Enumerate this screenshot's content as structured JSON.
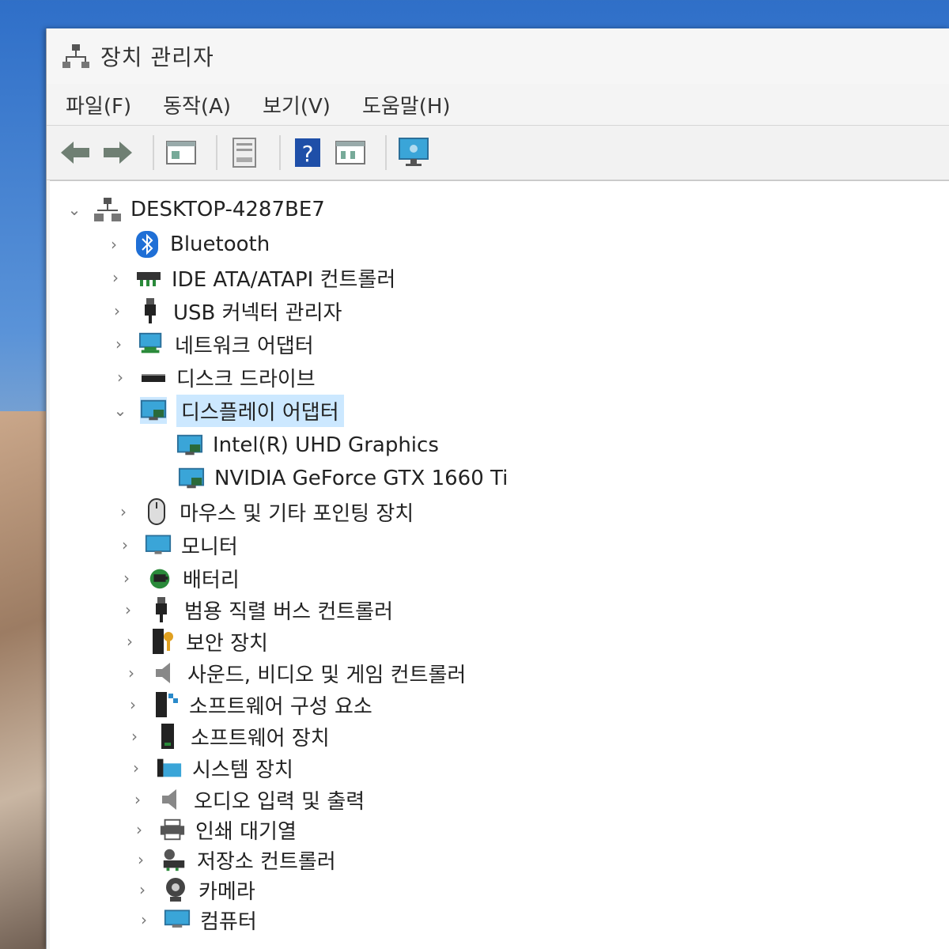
{
  "window": {
    "title": "장치 관리자"
  },
  "menu": [
    "파일(F)",
    "동작(A)",
    "보기(V)",
    "도움말(H)"
  ],
  "toolbar": [
    "back-icon",
    "forward-icon",
    "properties-icon",
    "update-driver-icon",
    "help-icon",
    "view-icon",
    "monitor-scan-icon"
  ],
  "tree": {
    "root": "DESKTOP-4287BE7",
    "items": [
      {
        "label": "Bluetooth",
        "icon": "bluetooth-icon",
        "expanded": false
      },
      {
        "label": "IDE ATA/ATAPI 컨트롤러",
        "icon": "ide-controller-icon",
        "expanded": false
      },
      {
        "label": "USB 커넥터 관리자",
        "icon": "usb-icon",
        "expanded": false
      },
      {
        "label": "네트워크 어댑터",
        "icon": "network-icon",
        "expanded": false
      },
      {
        "label": "디스크 드라이브",
        "icon": "disk-icon",
        "expanded": false
      },
      {
        "label": "디스플레이 어댑터",
        "icon": "display-adapter-icon",
        "expanded": true,
        "selected": true,
        "children": [
          {
            "label": "Intel(R) UHD Graphics",
            "icon": "display-adapter-icon"
          },
          {
            "label": "NVIDIA GeForce GTX 1660 Ti",
            "icon": "display-adapter-icon"
          }
        ]
      },
      {
        "label": "마우스 및 기타 포인팅 장치",
        "icon": "mouse-icon",
        "expanded": false
      },
      {
        "label": "모니터",
        "icon": "monitor-icon",
        "expanded": false
      },
      {
        "label": "배터리",
        "icon": "battery-icon",
        "expanded": false
      },
      {
        "label": "범용 직렬 버스 컨트롤러",
        "icon": "usb-icon",
        "expanded": false
      },
      {
        "label": "보안 장치",
        "icon": "security-icon",
        "expanded": false
      },
      {
        "label": "사운드, 비디오 및 게임 컨트롤러",
        "icon": "speaker-icon",
        "expanded": false
      },
      {
        "label": "소프트웨어 구성 요소",
        "icon": "software-component-icon",
        "expanded": false
      },
      {
        "label": "소프트웨어 장치",
        "icon": "software-device-icon",
        "expanded": false
      },
      {
        "label": "시스템 장치",
        "icon": "system-folder-icon",
        "expanded": false
      },
      {
        "label": "오디오 입력 및 출력",
        "icon": "speaker-icon",
        "expanded": false
      },
      {
        "label": "인쇄 대기열",
        "icon": "printer-icon",
        "expanded": false
      },
      {
        "label": "저장소 컨트롤러",
        "icon": "storage-controller-icon",
        "expanded": false
      },
      {
        "label": "카메라",
        "icon": "camera-icon",
        "expanded": false
      },
      {
        "label": "컴퓨터",
        "icon": "computer-icon",
        "expanded": false
      }
    ]
  }
}
